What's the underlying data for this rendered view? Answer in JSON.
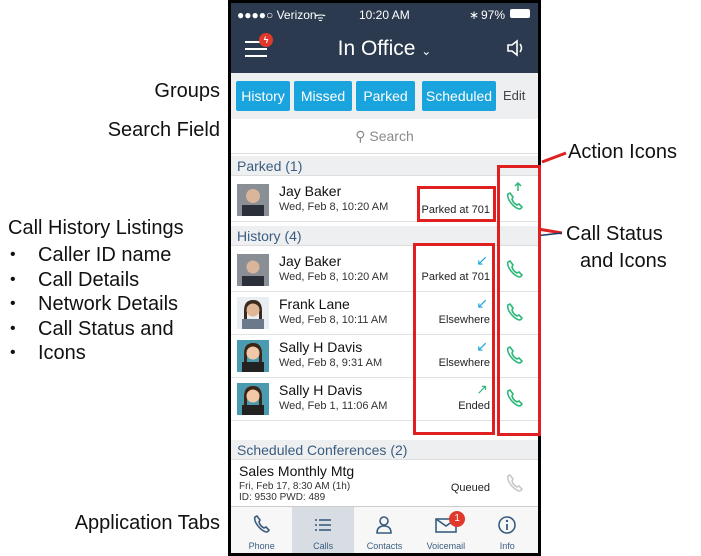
{
  "annotations": {
    "groups": "Groups",
    "search_field": "Search Field",
    "call_history": "Call History Listings",
    "bullets": [
      "Caller ID name",
      "Call Details",
      "Network Details",
      "Call Status and",
      "Icons"
    ],
    "application_tabs": "Application Tabs",
    "action_icons": "Action Icons",
    "call_status_line1": "Call Status",
    "call_status_line2": "and Icons"
  },
  "statusbar": {
    "carrier": "●●●●○ Verizon",
    "time": "10:20 AM",
    "battery": "97%"
  },
  "navbar": {
    "title": "In Office",
    "menu_badge": ""
  },
  "groups": {
    "items": [
      "History",
      "Missed",
      "Parked",
      "Scheduled"
    ],
    "edit": "Edit"
  },
  "search": {
    "placeholder": "Search"
  },
  "sections": {
    "parked": "Parked (1)",
    "history": "History (4)",
    "scheduled": "Scheduled Conferences (2)"
  },
  "parked": [
    {
      "name": "Jay Baker",
      "details": "Wed, Feb 8, 10:20 AM",
      "status": "Parked at 701"
    }
  ],
  "history": [
    {
      "name": "Jay Baker",
      "details": "Wed, Feb 8, 10:20 AM",
      "status": "Parked at 701",
      "arrow": "↙",
      "arrow_color": "#1aa4dd"
    },
    {
      "name": "Frank Lane",
      "details": "Wed, Feb 8, 10:11 AM",
      "status": "Elsewhere",
      "arrow": "↙",
      "arrow_color": "#1aa4dd"
    },
    {
      "name": "Sally H Davis",
      "details": "Wed, Feb 8, 9:31 AM",
      "status": "Elsewhere",
      "arrow": "↙",
      "arrow_color": "#1aa4dd"
    },
    {
      "name": "Sally H Davis",
      "details": "Wed, Feb 1, 11:06 AM",
      "status": "Ended",
      "arrow": "↗",
      "arrow_color": "#2db87a"
    }
  ],
  "conference": {
    "name": "Sales Monthly Mtg",
    "line1": "Fri, Feb 17, 8:30 AM (1h)",
    "line2": "ID: 9530   PWD: 489",
    "status": "Queued"
  },
  "tabs": [
    {
      "label": "Phone",
      "icon": "phone-icon"
    },
    {
      "label": "Calls",
      "icon": "list-icon"
    },
    {
      "label": "Contacts",
      "icon": "contacts-icon"
    },
    {
      "label": "Voicemail",
      "icon": "voicemail-icon",
      "badge": "1"
    },
    {
      "label": "Info",
      "icon": "info-icon"
    }
  ],
  "colors": {
    "header": "#2b3a4e",
    "accent": "#1aa4dd",
    "call_green": "#2db87a",
    "annotation_red": "#e02020"
  }
}
